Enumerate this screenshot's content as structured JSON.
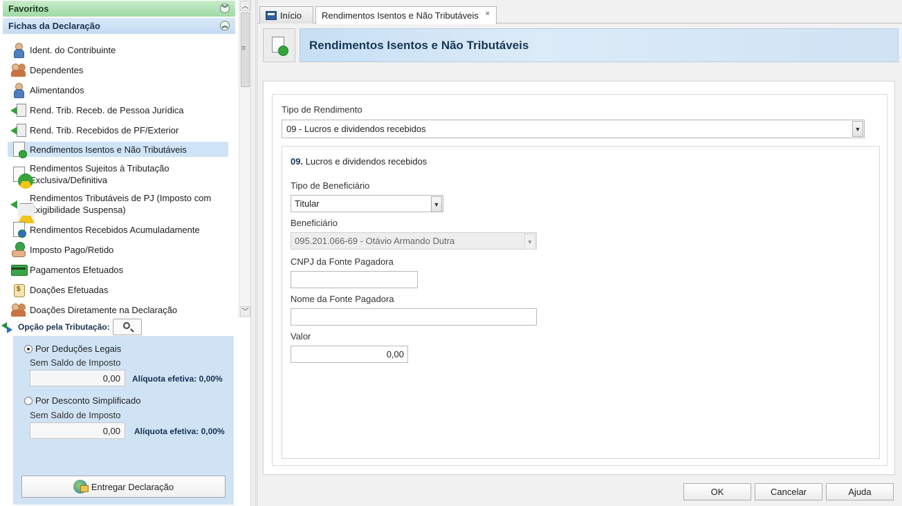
{
  "sidebar": {
    "favoritos_header": "Favoritos",
    "fichas_header": "Fichas da Declaração",
    "items": [
      {
        "label": "Ident. do Contribuinte",
        "icon": "person-icon"
      },
      {
        "label": "Dependentes",
        "icon": "people-icon"
      },
      {
        "label": "Alimentandos",
        "icon": "people-add-icon"
      },
      {
        "label": "Rend. Trib. Receb. de Pessoa Jurídica",
        "icon": "income-pj-icon"
      },
      {
        "label": "Rend. Trib. Recebidos de PF/Exterior",
        "icon": "income-pf-icon"
      },
      {
        "label": "Rendimentos Isentos e Não Tributáveis",
        "icon": "exempt-income-icon",
        "active": true
      },
      {
        "label1": "Rendimentos Sujeitos à Tributação",
        "label2": "Exclusiva/Definitiva",
        "icon": "exclusive-tax-icon"
      },
      {
        "label1": "Rendimentos Tributáveis de PJ (Imposto com",
        "label2": "Exigibilidade Suspensa)",
        "icon": "suspended-tax-icon"
      },
      {
        "label": "Rendimentos Recebidos Acumuladamente",
        "icon": "accumulated-income-icon"
      },
      {
        "label": "Imposto Pago/Retido",
        "icon": "tax-paid-icon"
      },
      {
        "label": "Pagamentos Efetuados",
        "icon": "payments-icon"
      },
      {
        "label": "Doações Efetuadas",
        "icon": "donations-icon"
      },
      {
        "label": "Doações Diretamente na Declaração",
        "icon": "direct-donations-icon"
      }
    ]
  },
  "tributacao": {
    "label": "Opção pela Tributação:",
    "deducoes": {
      "label": "Por Deduções Legais",
      "checked": true,
      "saldo_label": "Sem Saldo de Imposto",
      "value": "0,00",
      "aliquota": "Alíquota efetiva: 0,00%"
    },
    "simplificado": {
      "label": "Por Desconto Simplificado",
      "checked": false,
      "saldo_label": "Sem Saldo de Imposto",
      "value": "0,00",
      "aliquota": "Alíquota efetiva: 0,00%"
    },
    "entregar_label": "Entregar Declaração"
  },
  "tabs": {
    "inicio": "Início",
    "active": "Rendimentos Isentos e Não Tributáveis",
    "close": "×"
  },
  "page": {
    "title": "Rendimentos Isentos e Não Tributáveis"
  },
  "form": {
    "tipo_rendimento_label": "Tipo de Rendimento",
    "tipo_rendimento_value": "09 - Lucros e dividendos recebidos",
    "section_code": "09.",
    "section_title": "Lucros e dividendos recebidos",
    "tipo_beneficiario_label": "Tipo de Beneficiário",
    "tipo_beneficiario_value": "Titular",
    "beneficiario_label": "Beneficiário",
    "beneficiario_value": "095.201.066-69 - Otávio Armando Dutra",
    "cnpj_label": "CNPJ da Fonte Pagadora",
    "cnpj_value": "",
    "nome_label": "Nome da Fonte Pagadora",
    "nome_value": "",
    "valor_label": "Valor",
    "valor_value": "0,00"
  },
  "buttons": {
    "ok": "OK",
    "cancelar": "Cancelar",
    "ajuda": "Ajuda"
  },
  "colors": {
    "favoritos_bg": "#9fd9a5",
    "fichas_bg": "#c4daf2",
    "active_item_bg": "#cfe4f7",
    "title_text": "#173655"
  }
}
